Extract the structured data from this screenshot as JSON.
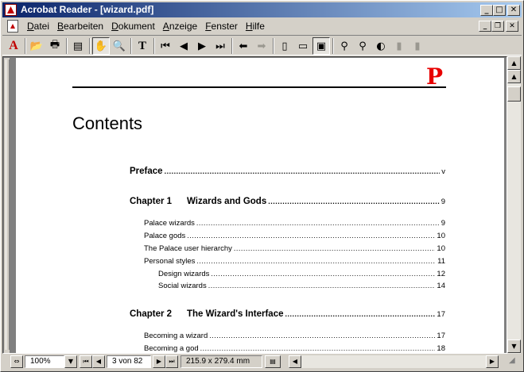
{
  "window": {
    "title": "Acrobat Reader - [wizard.pdf]",
    "controls": {
      "minimize": "_",
      "maximize": "□",
      "close": "✕"
    },
    "mdi_controls": {
      "minimize": "_",
      "restore": "❐",
      "close": "✕"
    }
  },
  "menu": {
    "items": [
      "Datei",
      "Bearbeiten",
      "Dokument",
      "Anzeige",
      "Fenster",
      "Hilfe"
    ]
  },
  "toolbar": {
    "glyphs": {
      "acrobat": "A",
      "open": "📂",
      "print": "🖶",
      "thumbnails": "▤",
      "hand": "✋",
      "zoom": "🔍",
      "text_select": "T",
      "first_page": "⏮",
      "prev_page": "◀",
      "next_page": "▶",
      "last_page": "⏭",
      "go_back": "⬅",
      "go_forward": "➡",
      "actual_size": "▯",
      "fit_page": "▭",
      "fit_width": "▣",
      "find": "⚲",
      "find_again": "⚲",
      "web": "◐",
      "page_back": "▮",
      "page_fwd": "▮"
    }
  },
  "document": {
    "logo_letter": "P",
    "heading": "Contents",
    "toc": [
      {
        "kind": "head",
        "label": "Preface",
        "num": "",
        "page": "v"
      },
      {
        "kind": "head",
        "label": "Wizards and Gods",
        "num": "Chapter 1",
        "page": "9"
      },
      {
        "kind": "sub",
        "label": "Palace wizards",
        "page": "9"
      },
      {
        "kind": "sub",
        "label": "Palace gods",
        "page": "10"
      },
      {
        "kind": "sub",
        "label": "The Palace user hierarchy",
        "page": "10"
      },
      {
        "kind": "sub",
        "label": "Personal styles",
        "page": "11"
      },
      {
        "kind": "subsub",
        "label": "Design wizards",
        "page": "12"
      },
      {
        "kind": "subsub",
        "label": "Social wizards",
        "page": "14"
      },
      {
        "kind": "head",
        "label": "The Wizard's Interface",
        "num": "Chapter 2",
        "page": "17"
      },
      {
        "kind": "sub",
        "label": "Becoming a wizard",
        "page": "17"
      },
      {
        "kind": "sub",
        "label": "Becoming a god",
        "page": "18"
      }
    ]
  },
  "statusbar": {
    "zoom": "100%",
    "page": "3 von 82",
    "page_size": "215.9 x 279.4 mm"
  }
}
